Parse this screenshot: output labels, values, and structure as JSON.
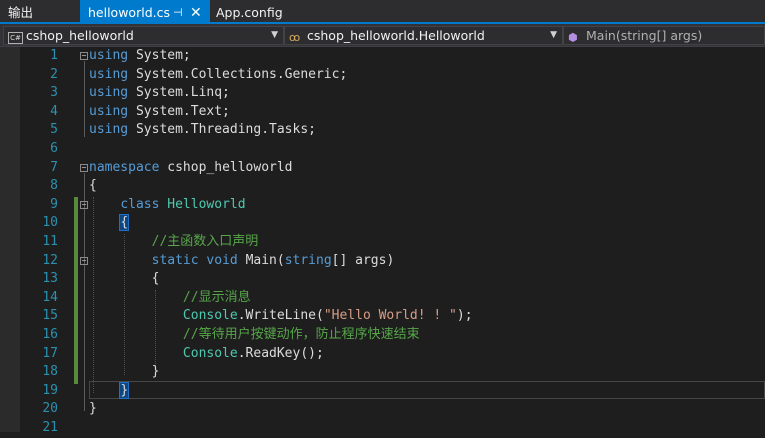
{
  "tabs": {
    "output": "输出",
    "active": "helloworld.cs",
    "active_pin": "⊣",
    "active_close": "✕",
    "other": "App.config"
  },
  "nav": {
    "project": "cshop_helloworld",
    "class": "cshop_helloworld.Helloworld",
    "member": "Main(string[] args)"
  },
  "code": {
    "line_numbers": [
      "1",
      "2",
      "3",
      "4",
      "5",
      "6",
      "7",
      "8",
      "9",
      "10",
      "11",
      "12",
      "13",
      "14",
      "15",
      "16",
      "17",
      "18",
      "19",
      "20",
      "21"
    ],
    "l1_kw": "using",
    "l1_rest": " System;",
    "l2_kw": "using",
    "l2_rest": " System.Collections.Generic;",
    "l3_kw": "using",
    "l3_rest": " System.Linq;",
    "l4_kw": "using",
    "l4_rest": " System.Text;",
    "l5_kw": "using",
    "l5_rest": " System.Threading.Tasks;",
    "l7_kw": "namespace",
    "l7_rest": " cshop_helloworld",
    "l8": "{",
    "l9_kw": "class",
    "l9_type": "Helloworld",
    "l10": "{",
    "l11_comment": "//主函数入口声明",
    "l12_kw1": "static",
    "l12_kw2": "void",
    "l12_name": "Main(",
    "l12_kw3": "string",
    "l12_rest": "[] args)",
    "l13": "{",
    "l14_comment": "//显示消息",
    "l15_type": "Console",
    "l15_mid": ".WriteLine(",
    "l15_str": "\"Hello World! ! \"",
    "l15_end": ");",
    "l16_comment": "//等待用户按键动作，防止程序快速结束",
    "l17_type": "Console",
    "l17_rest": ".ReadKey();",
    "l18": "}",
    "l19": "}",
    "l20": "}"
  }
}
